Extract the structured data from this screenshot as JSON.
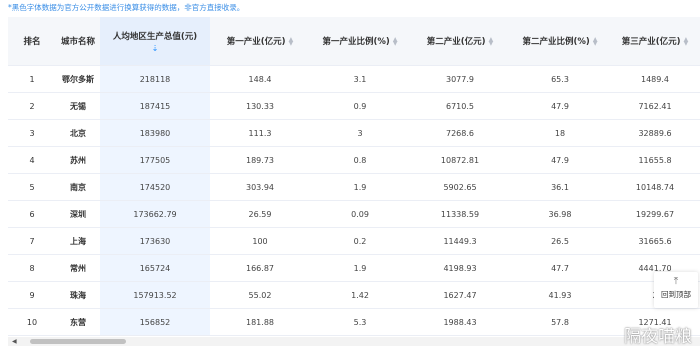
{
  "note": "*黑色字体数据为官方公开数据进行换算获得的数据，非官方直接收录。",
  "headers": {
    "rank": "排名",
    "city": "城市名称",
    "gdp_per_capita": "人均地区生产总值(元)",
    "primary": "第一产业(亿元)",
    "primary_ratio": "第一产业比例(%)",
    "secondary": "第二产业(亿元)",
    "secondary_ratio": "第二产业比例(%)",
    "tertiary": "第三产业(亿元)"
  },
  "rows": [
    {
      "rank": "1",
      "city": "鄂尔多斯",
      "gdp": "218118",
      "primary": "148.4",
      "primary_ratio": "3.1",
      "secondary": "3077.9",
      "secondary_ratio": "65.3",
      "tertiary": "1489.4"
    },
    {
      "rank": "2",
      "city": "无锡",
      "gdp": "187415",
      "primary": "130.33",
      "primary_ratio": "0.9",
      "secondary": "6710.5",
      "secondary_ratio": "47.9",
      "tertiary": "7162.41"
    },
    {
      "rank": "3",
      "city": "北京",
      "gdp": "183980",
      "primary": "111.3",
      "primary_ratio": "3",
      "secondary": "7268.6",
      "secondary_ratio": "18",
      "tertiary": "32889.6"
    },
    {
      "rank": "4",
      "city": "苏州",
      "gdp": "177505",
      "primary": "189.73",
      "primary_ratio": "0.8",
      "secondary": "10872.81",
      "secondary_ratio": "47.9",
      "tertiary": "11655.8"
    },
    {
      "rank": "5",
      "city": "南京",
      "gdp": "174520",
      "primary": "303.94",
      "primary_ratio": "1.9",
      "secondary": "5902.65",
      "secondary_ratio": "36.1",
      "tertiary": "10148.74"
    },
    {
      "rank": "6",
      "city": "深圳",
      "gdp": "173662.79",
      "primary": "26.59",
      "primary_ratio": "0.09",
      "secondary": "11338.59",
      "secondary_ratio": "36.98",
      "tertiary": "19299.67"
    },
    {
      "rank": "7",
      "city": "上海",
      "gdp": "173630",
      "primary": "100",
      "primary_ratio": "0.2",
      "secondary": "11449.3",
      "secondary_ratio": "26.5",
      "tertiary": "31665.6"
    },
    {
      "rank": "8",
      "city": "常州",
      "gdp": "165724",
      "primary": "166.87",
      "primary_ratio": "1.9",
      "secondary": "4198.93",
      "secondary_ratio": "47.7",
      "tertiary": "4441.70"
    },
    {
      "rank": "9",
      "city": "珠海",
      "gdp": "157913.52",
      "primary": "55.02",
      "primary_ratio": "1.42",
      "secondary": "1627.47",
      "secondary_ratio": "41.93",
      "tertiary": "2"
    },
    {
      "rank": "10",
      "city": "东营",
      "gdp": "156852",
      "primary": "181.88",
      "primary_ratio": "5.3",
      "secondary": "1988.43",
      "secondary_ratio": "57.8",
      "tertiary": "1271.41"
    }
  ],
  "back_to_top": "回到顶部",
  "watermark": "隔夜喵粮",
  "icons": {
    "sort": "sort-icon",
    "sort_active": "sort-down-icon",
    "back_to_top": "arrow-up-icon"
  },
  "colors": {
    "note": "#3a8ee6",
    "highlight_column": "#eef5ff",
    "sort_active": "#409eff"
  }
}
